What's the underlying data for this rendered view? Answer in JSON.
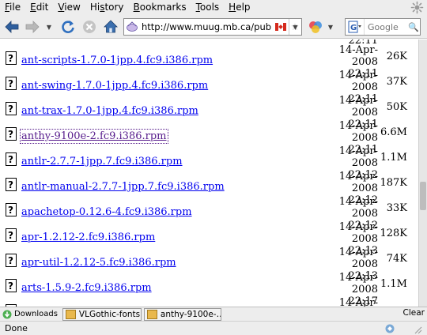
{
  "menu": {
    "items": [
      {
        "label": "File",
        "u": "F",
        "rest": "ile"
      },
      {
        "label": "Edit",
        "u": "E",
        "rest": "dit"
      },
      {
        "label": "View",
        "u": "V",
        "rest": "iew"
      },
      {
        "label": "History",
        "u": "s",
        "pre": "Hi",
        "rest": "tory"
      },
      {
        "label": "Bookmarks",
        "u": "B",
        "rest": "ookmarks"
      },
      {
        "label": "Tools",
        "u": "T",
        "rest": "ools"
      },
      {
        "label": "Help",
        "u": "H",
        "rest": "elp"
      }
    ]
  },
  "toolbar": {
    "url": "http://www.muug.mb.ca/pub",
    "search_placeholder": "Google"
  },
  "listing": {
    "top_time": "22:11",
    "rows": [
      {
        "name": "ant-scripts-1.7.0-1jpp.4.fc9.i386.rpm",
        "date": "14-Apr-2008",
        "time": "22:11",
        "size": "26K",
        "visited": false
      },
      {
        "name": "ant-swing-1.7.0-1jpp.4.fc9.i386.rpm",
        "date": "14-Apr-2008",
        "time": "22:11",
        "size": "37K",
        "visited": false
      },
      {
        "name": "ant-trax-1.7.0-1jpp.4.fc9.i386.rpm",
        "date": "14-Apr-2008",
        "time": "22:11",
        "size": "50K",
        "visited": false
      },
      {
        "name": "anthy-9100e-2.fc9.i386.rpm",
        "date": "14-Apr-2008",
        "time": "22:11",
        "size": "6.6M",
        "visited": true
      },
      {
        "name": "antlr-2.7.7-1jpp.7.fc9.i386.rpm",
        "date": "14-Apr-2008",
        "time": "22:12",
        "size": "1.1M",
        "visited": false
      },
      {
        "name": "antlr-manual-2.7.7-1jpp.7.fc9.i386.rpm",
        "date": "14-Apr-2008",
        "time": "22:12",
        "size": "187K",
        "visited": false
      },
      {
        "name": "apachetop-0.12.6-4.fc9.i386.rpm",
        "date": "14-Apr-2008",
        "time": "22:12",
        "size": "33K",
        "visited": false
      },
      {
        "name": "apr-1.2.12-2.fc9.i386.rpm",
        "date": "14-Apr-2008",
        "time": "22:13",
        "size": "128K",
        "visited": false
      },
      {
        "name": "apr-util-1.2.12-5.fc9.i386.rpm",
        "date": "14-Apr-2008",
        "time": "22:13",
        "size": "74K",
        "visited": false
      },
      {
        "name": "arts-1.5.9-2.fc9.i386.rpm",
        "date": "14-Apr-2008",
        "time": "22:17",
        "size": "1.1M",
        "visited": false
      },
      {
        "name": "",
        "date": "14-Apr-2008",
        "time": "",
        "size": "",
        "visited": false
      }
    ]
  },
  "downloads": {
    "label": "Downloads",
    "items": [
      "VLGothic-fonts…",
      "anthy-9100e-…"
    ],
    "clear_label": "Clear"
  },
  "status": {
    "text": "Done"
  },
  "colors": {
    "link": "#0000ee",
    "visited": "#551a8b",
    "chrome": "#ededed"
  }
}
